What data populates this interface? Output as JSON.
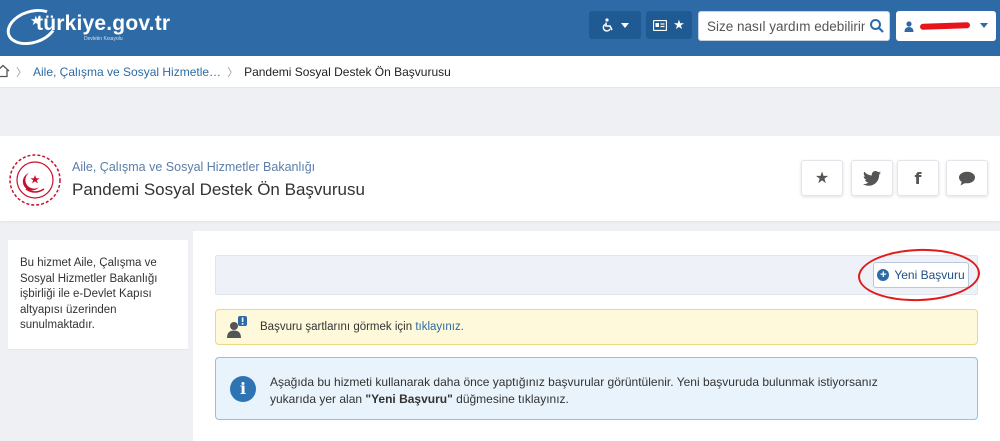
{
  "header": {
    "logo_text": "türkiye.gov.tr",
    "logo_subtext": "Devletin Kısayolu",
    "search_placeholder": "Size nasıl yardım edebilirim?"
  },
  "breadcrumb": {
    "items": [
      "Aile, Çalışma ve Sosyal Hizmetle…",
      "Pandemi Sosyal Destek Ön Başvurusu"
    ]
  },
  "service": {
    "organization": "Aile, Çalışma ve Sosyal Hizmetler Bakanlığı",
    "title": "Pandemi Sosyal Destek Ön Başvurusu"
  },
  "sidebar": {
    "description": "Bu hizmet Aile, Çalışma ve Sosyal Hizmetler Bakanlığı işbirliği ile e-Devlet Kapısı altyapısı üzerinden sunulmaktadır."
  },
  "main": {
    "new_application_label": "Yeni Başvuru",
    "warning_prefix": "Başvuru şartlarını görmek için ",
    "warning_link": "tıklayınız.",
    "info_line1": "Aşağıda bu hizmeti kullanarak daha önce yaptığınız başvurular görüntülenir. Yeni başvuruda bulunmak istiyorsanız",
    "info_prefix": "yukarıda yer alan ",
    "info_bold": "\"Yeni Başvuru\"",
    "info_suffix": " düğmesine tıklayınız."
  },
  "colors": {
    "brand_blue": "#2e6ba6",
    "annotation_red": "#e11a1a",
    "warning_bg": "#fff9db",
    "info_bg": "#e8f3fb"
  },
  "icons": [
    "accessibility-icon",
    "id-card-icon",
    "star-icon",
    "search-icon",
    "user-icon",
    "home-icon",
    "twitter-icon",
    "facebook-icon",
    "comment-icon",
    "info-icon",
    "plus-circle-icon",
    "user-alert-icon"
  ]
}
